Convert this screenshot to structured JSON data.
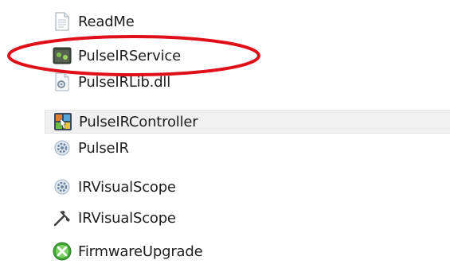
{
  "files": [
    {
      "label": "ReadMe",
      "icon": "text-document-icon"
    },
    {
      "label": "PulseIRService",
      "icon": "service-application-icon"
    },
    {
      "label": "PulseIRLib.dll",
      "icon": "dll-file-icon"
    },
    {
      "label": "PulseIRController",
      "icon": "controller-application-icon",
      "selected": true
    },
    {
      "label": "PulseIR",
      "icon": "settings-gear-file-icon"
    },
    {
      "label": "IRVisualScope",
      "icon": "settings-gear-file-icon"
    },
    {
      "label": "IRVisualScope",
      "icon": "tools-icon"
    },
    {
      "label": "FirmwareUpgrade",
      "icon": "firmware-upgrade-icon"
    }
  ],
  "colors": {
    "annotation_red": "#e0101a",
    "selection_bg": "#f0f0f0"
  }
}
